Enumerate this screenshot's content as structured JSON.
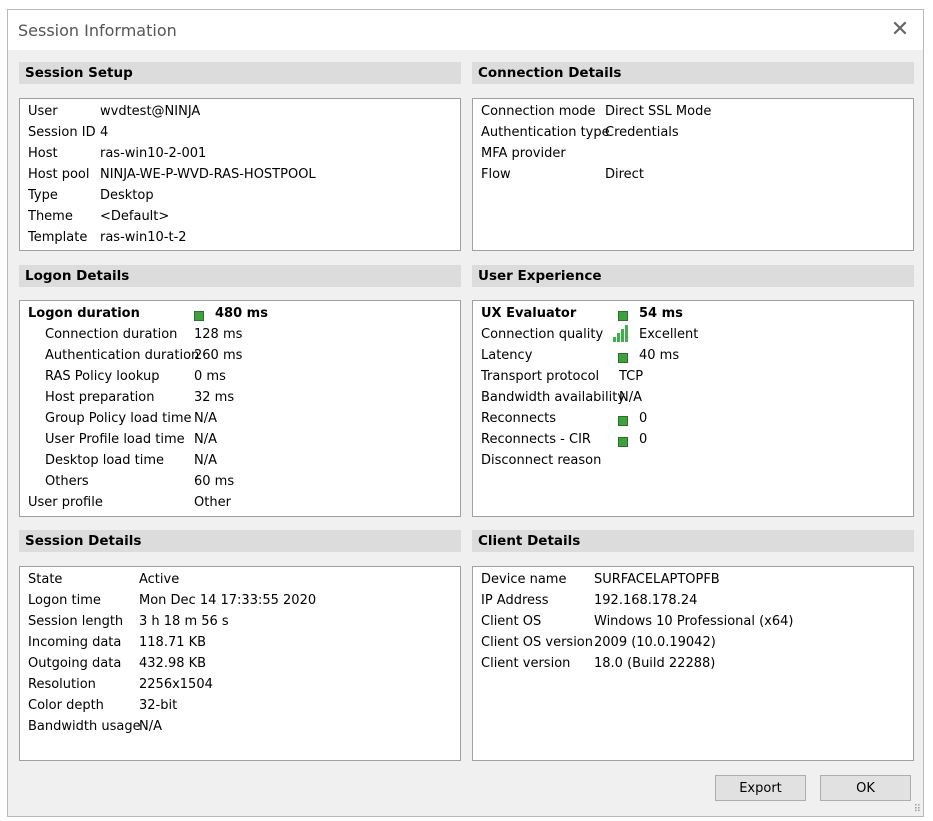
{
  "window": {
    "title": "Session Information"
  },
  "session_setup": {
    "header": "Session Setup",
    "rows": [
      {
        "label": "User",
        "value": "wvdtest@NINJA"
      },
      {
        "label": "Session ID",
        "value": "4"
      },
      {
        "label": "Host",
        "value": "ras-win10-2-001"
      },
      {
        "label": "Host pool",
        "value": "NINJA-WE-P-WVD-RAS-HOSTPOOL"
      },
      {
        "label": "Type",
        "value": "Desktop"
      },
      {
        "label": "Theme",
        "value": "<Default>"
      },
      {
        "label": "Template",
        "value": "ras-win10-t-2"
      }
    ]
  },
  "connection_details": {
    "header": "Connection Details",
    "rows": [
      {
        "label": "Connection mode",
        "value": "Direct SSL Mode"
      },
      {
        "label": "Authentication type",
        "value": "Credentials"
      },
      {
        "label": "MFA provider",
        "value": ""
      },
      {
        "label": "Flow",
        "value": "Direct"
      }
    ]
  },
  "logon_details": {
    "header": "Logon Details",
    "total": {
      "label": "Logon duration",
      "value": "480 ms",
      "status": "good"
    },
    "rows": [
      {
        "label": "Connection duration",
        "value": "128 ms"
      },
      {
        "label": "Authentication duration",
        "value": "260 ms"
      },
      {
        "label": "RAS Policy lookup",
        "value": "0 ms"
      },
      {
        "label": "Host preparation",
        "value": "32 ms"
      },
      {
        "label": "Group Policy load time",
        "value": "N/A"
      },
      {
        "label": "User Profile load time",
        "value": "N/A"
      },
      {
        "label": "Desktop load time",
        "value": "N/A"
      },
      {
        "label": "Others",
        "value": "60 ms"
      }
    ],
    "user_profile": {
      "label": "User profile",
      "value": "Other"
    }
  },
  "user_experience": {
    "header": "User Experience",
    "ux_evaluator": {
      "label": "UX Evaluator",
      "value": "54 ms",
      "status": "good"
    },
    "connection_quality": {
      "label": "Connection quality",
      "value": "Excellent",
      "bars": 4
    },
    "latency": {
      "label": "Latency",
      "value": "40 ms",
      "status": "good"
    },
    "transport_protocol": {
      "label": "Transport protocol",
      "value": "TCP"
    },
    "bandwidth_availability": {
      "label": "Bandwidth availability",
      "value": "N/A"
    },
    "reconnects": {
      "label": "Reconnects",
      "value": "0",
      "status": "good"
    },
    "reconnects_cir": {
      "label": "Reconnects - CIR",
      "value": "0",
      "status": "good"
    },
    "disconnect_reason": {
      "label": "Disconnect reason",
      "value": ""
    }
  },
  "session_details": {
    "header": "Session Details",
    "rows": [
      {
        "label": "State",
        "value": "Active"
      },
      {
        "label": "Logon time",
        "value": "Mon Dec 14 17:33:55 2020"
      },
      {
        "label": "Session length",
        "value": "3 h 18 m 56 s"
      },
      {
        "label": "Incoming data",
        "value": "118.71 KB"
      },
      {
        "label": "Outgoing data",
        "value": "432.98 KB"
      },
      {
        "label": "Resolution",
        "value": "2256x1504"
      },
      {
        "label": "Color depth",
        "value": "32-bit"
      },
      {
        "label": "Bandwidth usage",
        "value": "N/A"
      }
    ]
  },
  "client_details": {
    "header": "Client Details",
    "rows": [
      {
        "label": "Device name",
        "value": "SURFACELAPTOPFB"
      },
      {
        "label": "IP Address",
        "value": "192.168.178.24"
      },
      {
        "label": "Client OS",
        "value": "Windows 10 Professional (x64)"
      },
      {
        "label": "Client OS version",
        "value": "2009 (10.0.19042)"
      },
      {
        "label": "Client version",
        "value": "18.0 (Build 22288)"
      }
    ]
  },
  "buttons": {
    "export": "Export",
    "ok": "OK"
  },
  "icons": {
    "close": "close-icon",
    "status": "green-square-icon",
    "signal": "signal-bars-icon",
    "grip": "resize-grip-icon"
  },
  "colors": {
    "status_good": "#3fa03f",
    "signal": "#3fb04f"
  }
}
